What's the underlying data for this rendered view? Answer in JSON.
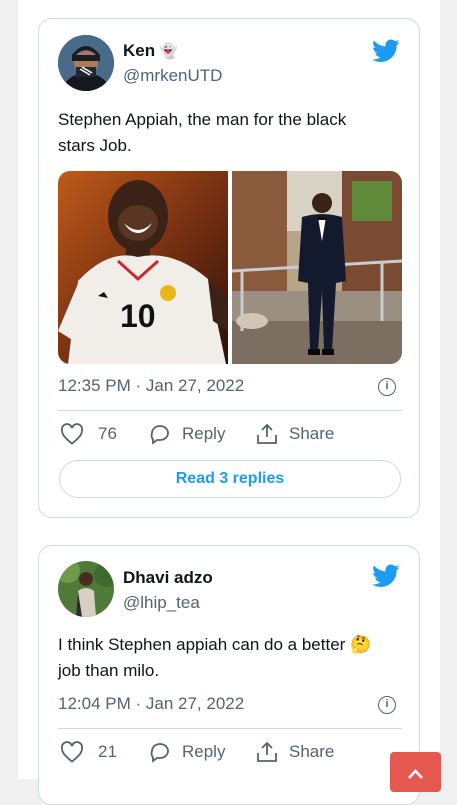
{
  "tweets": [
    {
      "name": "Ken",
      "name_emoji": "👻",
      "handle": "@mrkenUTD",
      "text_line1": "Stephen Appiah, the man for the black",
      "text_line2": "stars Job.",
      "time": "12:35 PM · Jan 27, 2022",
      "likes": "76",
      "reply_label": "Reply",
      "share_label": "Share",
      "read_replies": "Read 3 replies",
      "jersey_number": "10"
    },
    {
      "name": "Dhavi adzo",
      "handle": "@lhip_tea",
      "text_line1": "I think Stephen appiah can do a better",
      "text_emoji": "🤔",
      "text_line2": "job than milo.",
      "time": "12:04 PM · Jan 27, 2022",
      "likes": "21",
      "reply_label": "Reply",
      "share_label": "Share"
    }
  ],
  "colors": {
    "twitter_blue": "#1d9bf0",
    "border": "#cfd9de",
    "muted": "#536471",
    "scroll_button": "#e5584f"
  },
  "icons": [
    "twitter-bird-icon",
    "heart-icon",
    "reply-icon",
    "share-icon",
    "info-icon",
    "chevron-up-icon"
  ]
}
